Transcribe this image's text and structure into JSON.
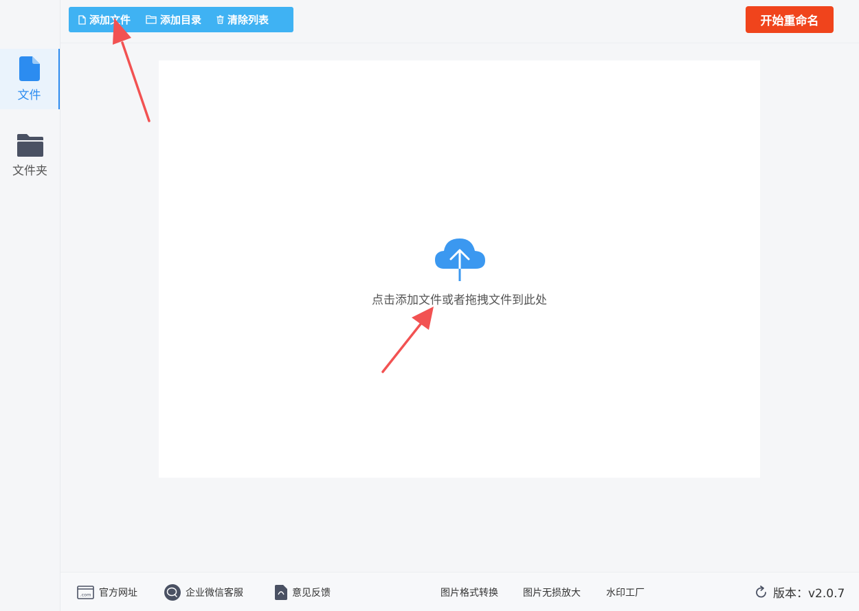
{
  "sidebar": {
    "items": [
      {
        "label": "文件",
        "icon": "file-icon"
      },
      {
        "label": "文件夹",
        "icon": "folder-icon"
      }
    ]
  },
  "toolbar": {
    "add_file": "添加文件",
    "add_dir": "添加目录",
    "clear_list": "清除列表"
  },
  "start_button": "开始重命名",
  "dropzone": {
    "hint": "点击添加文件或者拖拽文件到此处",
    "icon": "cloud-upload-icon"
  },
  "footer": {
    "website": "官方网址",
    "wechat_service": "企业微信客服",
    "feedback": "意见反馈",
    "format_convert": "图片格式转换",
    "lossless_upscale": "图片无损放大",
    "watermark_factory": "水印工厂",
    "version": "版本：v2.0.7"
  },
  "colors": {
    "toolbar_bg": "#3fb2f3",
    "start_button_bg": "#f0441c",
    "accent": "#2c8cf0",
    "arrow": "#f25252"
  }
}
